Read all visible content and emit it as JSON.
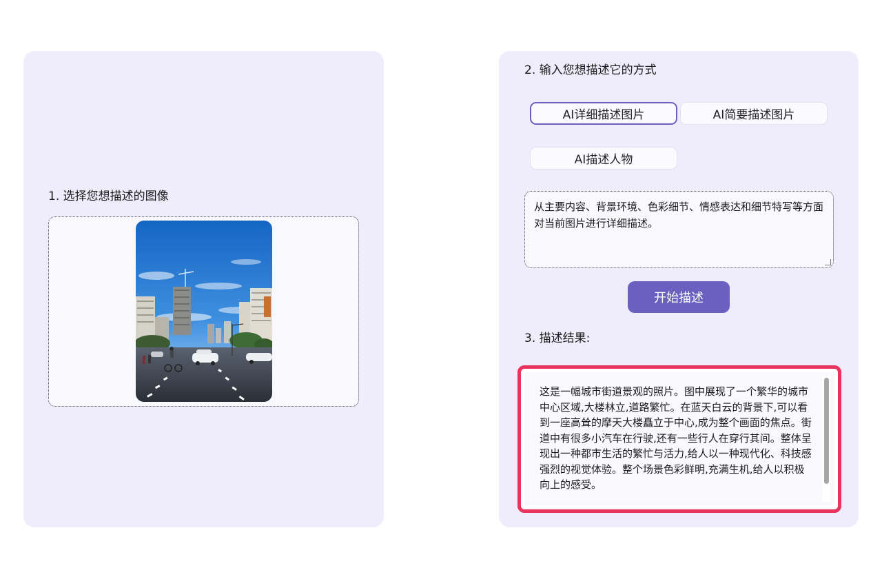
{
  "left_panel": {
    "title": "1. 选择您想描述的图像",
    "image_alt": "城市街道照片"
  },
  "right_panel": {
    "title": "2. 输入您想描述它的方式",
    "options": [
      {
        "label": "AI详细描述图片",
        "selected": true
      },
      {
        "label": "AI简要描述图片",
        "selected": false
      },
      {
        "label": "AI描述人物",
        "selected": false
      }
    ],
    "prompt_text": "从主要内容、背景环境、色彩细节、情感表达和细节特写等方面对当前图片进行详细描述。",
    "start_button": "开始描述",
    "result_title": "3. 描述结果:",
    "result_text": "这是一幅城市街道景观的照片。图中展现了一个繁华的城市中心区域,大楼林立,道路繁忙。在蓝天白云的背景下,可以看到一座高耸的摩天大楼矗立于中心,成为整个画面的焦点。街道中有很多小汽车在行驶,还有一些行人在穿行其间。整体呈现出一种都市生活的繁忙与活力,给人以一种现代化、科技感强烈的视觉体验。整个场景色彩鲜明,充满生机,给人以积极向上的感受。"
  },
  "colors": {
    "card_bg": "#efedfb",
    "accent": "#6b5fc0",
    "highlight_border": "#e8345c"
  }
}
